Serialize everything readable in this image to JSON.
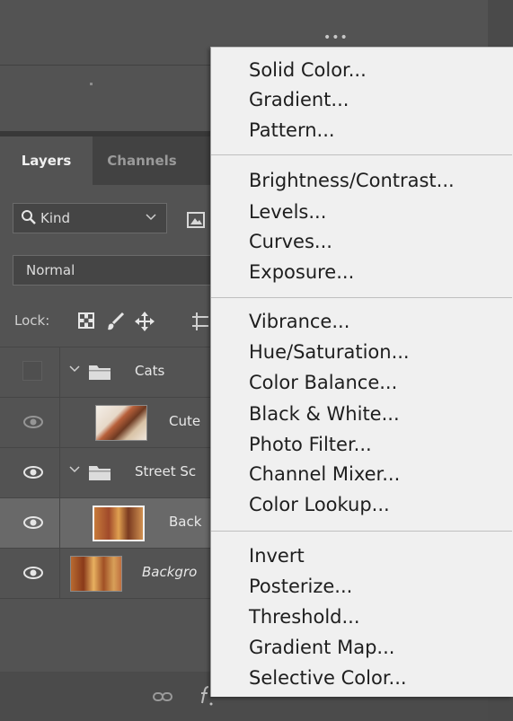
{
  "panel": {
    "tabs": [
      {
        "label": "Layers",
        "active": true
      },
      {
        "label": "Channels",
        "active": false
      }
    ],
    "filter": {
      "label": "Kind"
    },
    "blend_mode": "Normal",
    "lock_label": "Lock:",
    "layers": [
      {
        "name": "Cats",
        "type": "group",
        "visible": false
      },
      {
        "name": "Cute",
        "type": "layer",
        "visible": true
      },
      {
        "name": "Street Sc",
        "type": "group",
        "visible": true
      },
      {
        "name": "Back",
        "type": "layer",
        "visible": true,
        "selected": true
      },
      {
        "name": "Backgro",
        "type": "background",
        "visible": true
      }
    ]
  },
  "menu": {
    "groups": [
      [
        "Solid Color...",
        "Gradient...",
        "Pattern..."
      ],
      [
        "Brightness/Contrast...",
        "Levels...",
        "Curves...",
        "Exposure..."
      ],
      [
        "Vibrance...",
        "Hue/Saturation...",
        "Color Balance...",
        "Black & White...",
        "Photo Filter...",
        "Channel Mixer...",
        "Color Lookup..."
      ],
      [
        "Invert",
        "Posterize...",
        "Threshold...",
        "Gradient Map...",
        "Selective Color..."
      ]
    ]
  },
  "colors": {
    "panel_bg": "#535353",
    "tab_bar_bg": "#424242",
    "menu_bg": "#f0f0f0",
    "menu_text": "#1e1e1e",
    "selected_row_bg": "#696969"
  },
  "icons": [
    "more-dots-icon",
    "search-icon",
    "chevron-down-icon",
    "image-filter-icon",
    "lock-transparent-pixels-icon",
    "lock-brush-icon",
    "lock-position-icon",
    "artboard-icon",
    "eye-icon",
    "folder-icon",
    "link-icon",
    "fx-icon"
  ]
}
